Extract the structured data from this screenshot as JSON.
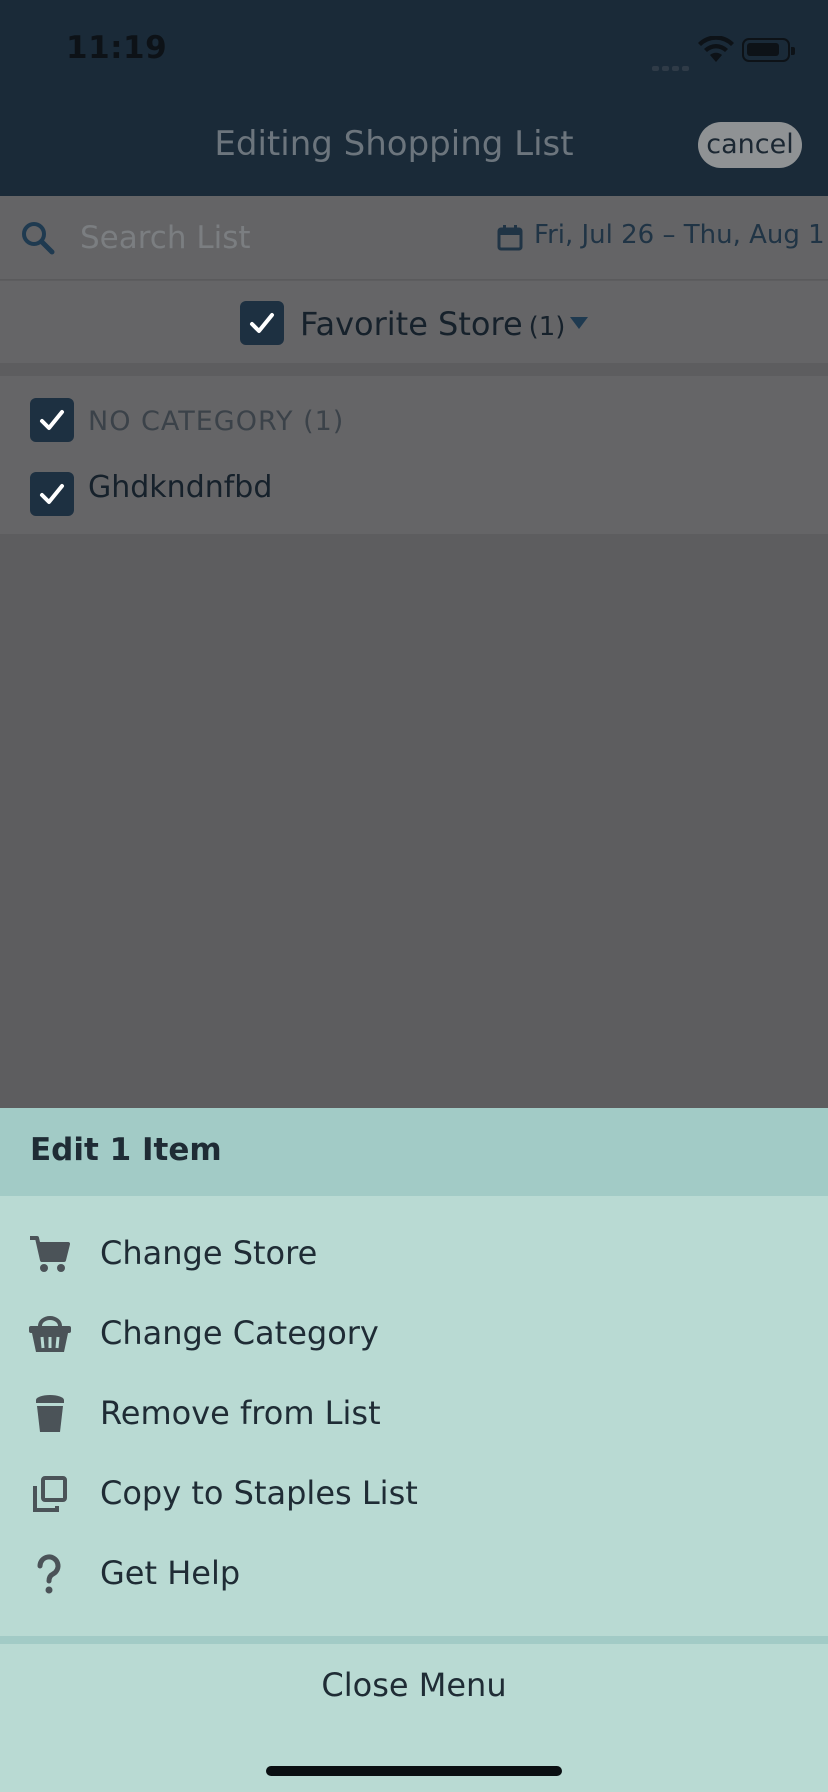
{
  "status_bar": {
    "time": "11:19"
  },
  "nav": {
    "title": "Editing Shopping List",
    "cancel_label": "cancel"
  },
  "search": {
    "placeholder": "Search List",
    "date_range": "Fri, Jul 26 – Thu, Aug 1"
  },
  "store": {
    "name": "Favorite Store",
    "count": "(1)",
    "checked": true
  },
  "list": {
    "category": {
      "label": "NO CATEGORY (1)",
      "checked": true
    },
    "items": [
      {
        "label": "Ghdkndnfbd",
        "checked": true
      }
    ]
  },
  "menu": {
    "title": "Edit 1 Item",
    "items": [
      {
        "label": "Change Store",
        "icon": "cart-icon"
      },
      {
        "label": "Change Category",
        "icon": "basket-icon"
      },
      {
        "label": "Remove from List",
        "icon": "trash-icon"
      },
      {
        "label": "Copy to Staples List",
        "icon": "copy-icon"
      },
      {
        "label": "Get Help",
        "icon": "question-icon"
      }
    ],
    "close_label": "Close Menu"
  },
  "colors": {
    "nav_bg": "#1a2a38",
    "menu_bg": "#b9dad3",
    "menu_header_bg": "#a2cbc6",
    "check_bg": "#1d3041"
  }
}
